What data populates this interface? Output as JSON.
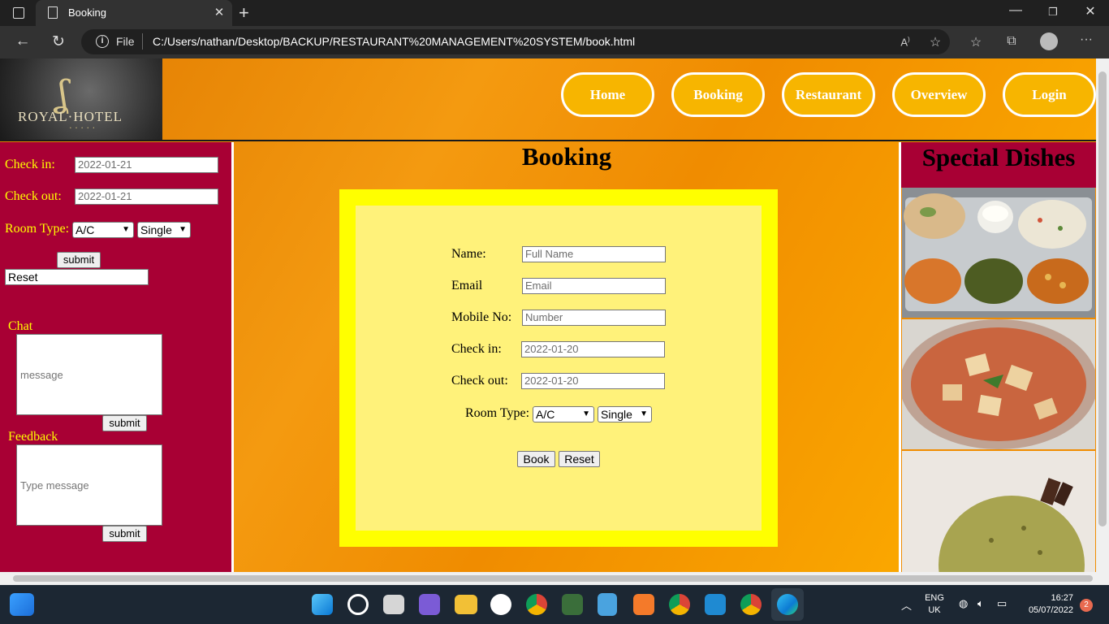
{
  "browser": {
    "tab_title": "Booking",
    "tab_close": "✕",
    "new_tab": "+",
    "file_label": "File",
    "url": "C:/Users/nathan/Desktop/BACKUP/RESTAURANT%20MANAGEMENT%20SYSTEM/book.html",
    "window_controls": [
      "—",
      "❐",
      "✕"
    ],
    "nav_icons": [
      "back-icon",
      "refresh-icon"
    ],
    "address_icons": [
      "read-aloud-icon",
      "add-favorite-icon",
      "favorites-icon",
      "collections-icon",
      "profile-icon",
      "more-icon"
    ]
  },
  "header": {
    "logo_text": "ROYAL·HOTEL",
    "logo_sub": "• • • • •",
    "nav": [
      "Home",
      "Booking",
      "Restaurant",
      "Overview",
      "Login"
    ]
  },
  "left_panel": {
    "check_in_label": "Check in:",
    "check_in_value": "2022-01-21",
    "check_out_label": "Check out:",
    "check_out_value": "2022-01-21",
    "room_type_label": "Room Type:",
    "room_ac": "A/C",
    "room_single": "Single",
    "submit": "submit",
    "reset": "Reset",
    "chat_label": "Chat",
    "chat_placeholder": "message",
    "chat_submit": "submit",
    "feedback_label": "Feedback",
    "feedback_placeholder": "Type message",
    "feedback_submit": "submit"
  },
  "booking": {
    "title": "Booking",
    "name_label": "Name:",
    "name_placeholder": "Full Name",
    "email_label": "Email",
    "email_placeholder": "Email",
    "mobile_label": "Mobile No:",
    "mobile_placeholder": "Number",
    "check_in_label": "Check in:",
    "check_in_value": "2022-01-20",
    "check_out_label": "Check out:",
    "check_out_value": "2022-01-20",
    "room_type_label": "Room Type:",
    "room_ac": "A/C",
    "room_single": "Single",
    "book_button": "Book",
    "reset_button": "Reset"
  },
  "right_panel": {
    "title": "Special Dishes"
  },
  "taskbar": {
    "lang_line1": "ENG",
    "lang_line2": "UK",
    "time": "16:27",
    "date": "05/07/2022",
    "notifications": "2"
  }
}
